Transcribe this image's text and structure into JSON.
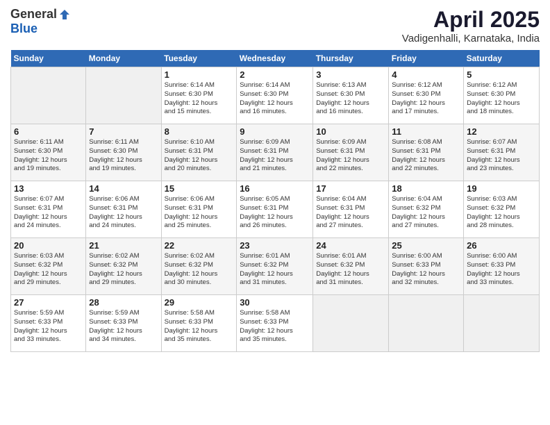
{
  "logo": {
    "general": "General",
    "blue": "Blue"
  },
  "header": {
    "month": "April 2025",
    "location": "Vadigenhalli, Karnataka, India"
  },
  "weekdays": [
    "Sunday",
    "Monday",
    "Tuesday",
    "Wednesday",
    "Thursday",
    "Friday",
    "Saturday"
  ],
  "weeks": [
    [
      {
        "day": "",
        "info": ""
      },
      {
        "day": "",
        "info": ""
      },
      {
        "day": "1",
        "info": "Sunrise: 6:14 AM\nSunset: 6:30 PM\nDaylight: 12 hours\nand 15 minutes."
      },
      {
        "day": "2",
        "info": "Sunrise: 6:14 AM\nSunset: 6:30 PM\nDaylight: 12 hours\nand 16 minutes."
      },
      {
        "day": "3",
        "info": "Sunrise: 6:13 AM\nSunset: 6:30 PM\nDaylight: 12 hours\nand 16 minutes."
      },
      {
        "day": "4",
        "info": "Sunrise: 6:12 AM\nSunset: 6:30 PM\nDaylight: 12 hours\nand 17 minutes."
      },
      {
        "day": "5",
        "info": "Sunrise: 6:12 AM\nSunset: 6:30 PM\nDaylight: 12 hours\nand 18 minutes."
      }
    ],
    [
      {
        "day": "6",
        "info": "Sunrise: 6:11 AM\nSunset: 6:30 PM\nDaylight: 12 hours\nand 19 minutes."
      },
      {
        "day": "7",
        "info": "Sunrise: 6:11 AM\nSunset: 6:30 PM\nDaylight: 12 hours\nand 19 minutes."
      },
      {
        "day": "8",
        "info": "Sunrise: 6:10 AM\nSunset: 6:31 PM\nDaylight: 12 hours\nand 20 minutes."
      },
      {
        "day": "9",
        "info": "Sunrise: 6:09 AM\nSunset: 6:31 PM\nDaylight: 12 hours\nand 21 minutes."
      },
      {
        "day": "10",
        "info": "Sunrise: 6:09 AM\nSunset: 6:31 PM\nDaylight: 12 hours\nand 22 minutes."
      },
      {
        "day": "11",
        "info": "Sunrise: 6:08 AM\nSunset: 6:31 PM\nDaylight: 12 hours\nand 22 minutes."
      },
      {
        "day": "12",
        "info": "Sunrise: 6:07 AM\nSunset: 6:31 PM\nDaylight: 12 hours\nand 23 minutes."
      }
    ],
    [
      {
        "day": "13",
        "info": "Sunrise: 6:07 AM\nSunset: 6:31 PM\nDaylight: 12 hours\nand 24 minutes."
      },
      {
        "day": "14",
        "info": "Sunrise: 6:06 AM\nSunset: 6:31 PM\nDaylight: 12 hours\nand 24 minutes."
      },
      {
        "day": "15",
        "info": "Sunrise: 6:06 AM\nSunset: 6:31 PM\nDaylight: 12 hours\nand 25 minutes."
      },
      {
        "day": "16",
        "info": "Sunrise: 6:05 AM\nSunset: 6:31 PM\nDaylight: 12 hours\nand 26 minutes."
      },
      {
        "day": "17",
        "info": "Sunrise: 6:04 AM\nSunset: 6:31 PM\nDaylight: 12 hours\nand 27 minutes."
      },
      {
        "day": "18",
        "info": "Sunrise: 6:04 AM\nSunset: 6:32 PM\nDaylight: 12 hours\nand 27 minutes."
      },
      {
        "day": "19",
        "info": "Sunrise: 6:03 AM\nSunset: 6:32 PM\nDaylight: 12 hours\nand 28 minutes."
      }
    ],
    [
      {
        "day": "20",
        "info": "Sunrise: 6:03 AM\nSunset: 6:32 PM\nDaylight: 12 hours\nand 29 minutes."
      },
      {
        "day": "21",
        "info": "Sunrise: 6:02 AM\nSunset: 6:32 PM\nDaylight: 12 hours\nand 29 minutes."
      },
      {
        "day": "22",
        "info": "Sunrise: 6:02 AM\nSunset: 6:32 PM\nDaylight: 12 hours\nand 30 minutes."
      },
      {
        "day": "23",
        "info": "Sunrise: 6:01 AM\nSunset: 6:32 PM\nDaylight: 12 hours\nand 31 minutes."
      },
      {
        "day": "24",
        "info": "Sunrise: 6:01 AM\nSunset: 6:32 PM\nDaylight: 12 hours\nand 31 minutes."
      },
      {
        "day": "25",
        "info": "Sunrise: 6:00 AM\nSunset: 6:33 PM\nDaylight: 12 hours\nand 32 minutes."
      },
      {
        "day": "26",
        "info": "Sunrise: 6:00 AM\nSunset: 6:33 PM\nDaylight: 12 hours\nand 33 minutes."
      }
    ],
    [
      {
        "day": "27",
        "info": "Sunrise: 5:59 AM\nSunset: 6:33 PM\nDaylight: 12 hours\nand 33 minutes."
      },
      {
        "day": "28",
        "info": "Sunrise: 5:59 AM\nSunset: 6:33 PM\nDaylight: 12 hours\nand 34 minutes."
      },
      {
        "day": "29",
        "info": "Sunrise: 5:58 AM\nSunset: 6:33 PM\nDaylight: 12 hours\nand 35 minutes."
      },
      {
        "day": "30",
        "info": "Sunrise: 5:58 AM\nSunset: 6:33 PM\nDaylight: 12 hours\nand 35 minutes."
      },
      {
        "day": "",
        "info": ""
      },
      {
        "day": "",
        "info": ""
      },
      {
        "day": "",
        "info": ""
      }
    ]
  ]
}
